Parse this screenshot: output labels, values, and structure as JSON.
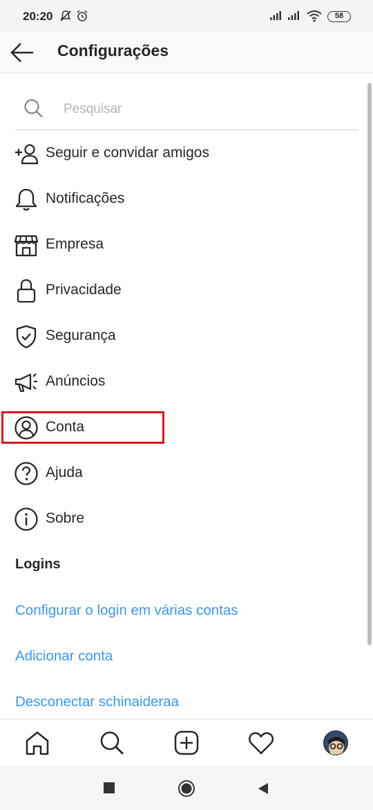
{
  "status_bar": {
    "time": "20:20",
    "battery": "58",
    "icons": [
      "notifications-off-icon",
      "alarm-icon",
      "signal-icon",
      "signal-icon",
      "wifi-icon",
      "battery-icon"
    ]
  },
  "header": {
    "title": "Configurações",
    "back_icon": "arrow-left-icon"
  },
  "search": {
    "placeholder": "Pesquisar",
    "value": ""
  },
  "menu": [
    {
      "label": "Seguir e convidar amigos",
      "icon": "add-person-icon"
    },
    {
      "label": "Notificações",
      "icon": "bell-icon"
    },
    {
      "label": "Empresa",
      "icon": "storefront-icon"
    },
    {
      "label": "Privacidade",
      "icon": "lock-icon"
    },
    {
      "label": "Segurança",
      "icon": "shield-check-icon"
    },
    {
      "label": "Anúncios",
      "icon": "megaphone-icon"
    },
    {
      "label": "Conta",
      "icon": "account-circle-icon"
    },
    {
      "label": "Ajuda",
      "icon": "help-circle-icon"
    },
    {
      "label": "Sobre",
      "icon": "info-circle-icon"
    }
  ],
  "logins": {
    "title": "Logins",
    "links": [
      "Configurar o login em várias contas",
      "Adicionar conta",
      "Desconectar schinaideraa"
    ]
  },
  "bottom_nav": [
    "home-icon",
    "search-icon",
    "add-post-icon",
    "heart-icon",
    "profile-avatar"
  ],
  "system_nav": [
    "recents-icon",
    "home-circle-icon",
    "back-triangle-icon"
  ],
  "colors": {
    "link": "#3897f0",
    "highlight": "#e3131b",
    "text": "#262626"
  }
}
